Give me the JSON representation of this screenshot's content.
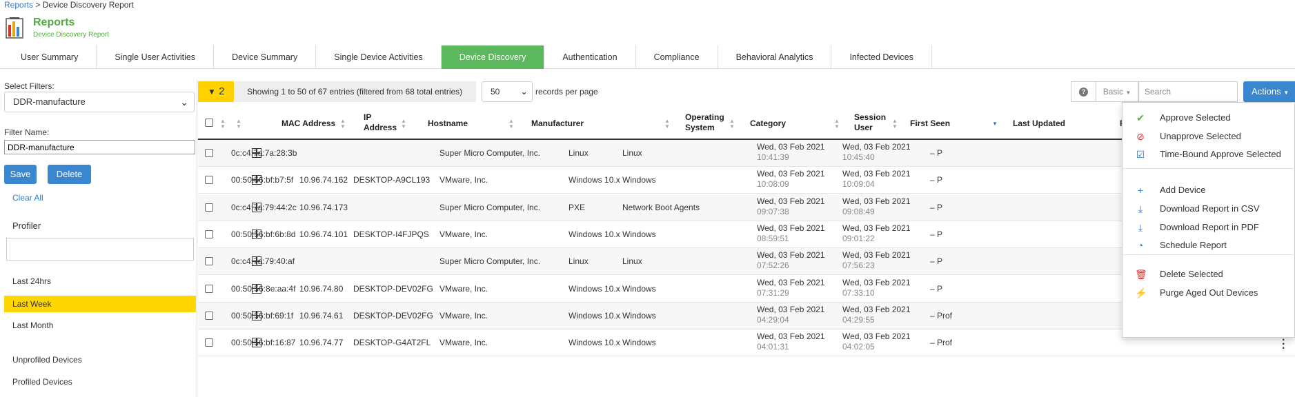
{
  "breadcrumb": {
    "root": "Reports",
    "sep": " > ",
    "current": "Device Discovery Report"
  },
  "header": {
    "title": "Reports",
    "subtitle": "Device Discovery Report"
  },
  "tabs": [
    "User Summary",
    "Single User Activities",
    "Device Summary",
    "Single Device Activities",
    "Device Discovery",
    "Authentication",
    "Compliance",
    "Behavioral Analytics",
    "Infected Devices"
  ],
  "active_tab": "Device Discovery",
  "left": {
    "select_filters_label": "Select Filters:",
    "selected_filter": "DDR-manufacture",
    "filter_name_label": "Filter Name:",
    "filter_name_value": "DDR-manufacture",
    "save": "Save",
    "delete": "Delete",
    "clear_all": "Clear All",
    "profiler_label": "Profiler",
    "time_items": [
      "Last 24hrs",
      "Last Week",
      "Last Month"
    ],
    "selected_time": "Last Week",
    "profile_items": [
      "Unprofiled Devices",
      "Profiled Devices"
    ]
  },
  "toolbar": {
    "filter_count": "2",
    "showing": "Showing 1 to 50 of 67 entries (filtered from 68 total entries)",
    "page_size": "50",
    "records_per_page": "records per page",
    "help": "?",
    "basic": "Basic",
    "search_placeholder": "Search",
    "actions": "Actions"
  },
  "columns": {
    "mac": "MAC Address",
    "ip_1": "IP",
    "ip_2": "Address",
    "hostname": "Hostname",
    "manufacturer": "Manufacturer",
    "os_1": "Operating",
    "os_2": "System",
    "category": "Category",
    "session_1": "Session",
    "session_2": "User",
    "first_seen": "First Seen",
    "last_updated": "Last Updated",
    "p": "P"
  },
  "rows": [
    {
      "mac": "0c:c4:7a:7a:28:3b",
      "ip": "",
      "hostname": "",
      "manufacturer": "Super Micro Computer, Inc.",
      "os": "Linux",
      "category": "Linux",
      "first_date": "Wed, 03 Feb 2021",
      "first_time": "10:41:39",
      "last_date": "Wed, 03 Feb 2021",
      "last_time": "10:45:40",
      "prof": "– P"
    },
    {
      "mac": "00:50:56:bf:b7:5f",
      "ip": "10.96.74.162",
      "hostname": "DESKTOP-A9CL193",
      "manufacturer": "VMware, Inc.",
      "os": "Windows 10.x",
      "category": "Windows",
      "first_date": "Wed, 03 Feb 2021",
      "first_time": "10:08:09",
      "last_date": "Wed, 03 Feb 2021",
      "last_time": "10:09:04",
      "prof": "– P"
    },
    {
      "mac": "0c:c4:7a:79:44:2c",
      "ip": "10.96.74.173",
      "hostname": "",
      "manufacturer": "Super Micro Computer, Inc.",
      "os": "PXE",
      "category": "Network Boot Agents",
      "first_date": "Wed, 03 Feb 2021",
      "first_time": "09:07:38",
      "last_date": "Wed, 03 Feb 2021",
      "last_time": "09:08:49",
      "prof": "– P"
    },
    {
      "mac": "00:50:56:bf:6b:8d",
      "ip": "10.96.74.101",
      "hostname": "DESKTOP-I4FJPQS",
      "manufacturer": "VMware, Inc.",
      "os": "Windows 10.x",
      "category": "Windows",
      "first_date": "Wed, 03 Feb 2021",
      "first_time": "08:59:51",
      "last_date": "Wed, 03 Feb 2021",
      "last_time": "09:01:22",
      "prof": "– P"
    },
    {
      "mac": "0c:c4:7a:79:40:af",
      "ip": "",
      "hostname": "",
      "manufacturer": "Super Micro Computer, Inc.",
      "os": "Linux",
      "category": "Linux",
      "first_date": "Wed, 03 Feb 2021",
      "first_time": "07:52:26",
      "last_date": "Wed, 03 Feb 2021",
      "last_time": "07:56:23",
      "prof": "– P"
    },
    {
      "mac": "00:50:56:8e:aa:4f",
      "ip": "10.96.74.80",
      "hostname": "DESKTOP-DEV02FG",
      "manufacturer": "VMware, Inc.",
      "os": "Windows 10.x",
      "category": "Windows",
      "first_date": "Wed, 03 Feb 2021",
      "first_time": "07:31:29",
      "last_date": "Wed, 03 Feb 2021",
      "last_time": "07:33:10",
      "prof": "– P"
    },
    {
      "mac": "00:50:56:bf:69:1f",
      "ip": "10.96.74.61",
      "hostname": "DESKTOP-DEV02FG",
      "manufacturer": "VMware, Inc.",
      "os": "Windows 10.x",
      "category": "Windows",
      "first_date": "Wed, 03 Feb 2021",
      "first_time": "04:29:04",
      "last_date": "Wed, 03 Feb 2021",
      "last_time": "04:29:55",
      "prof": "– Prof"
    },
    {
      "mac": "00:50:56:bf:16:87",
      "ip": "10.96.74.77",
      "hostname": "DESKTOP-G4AT2FL",
      "manufacturer": "VMware, Inc.",
      "os": "Windows 10.x",
      "category": "Windows",
      "first_date": "Wed, 03 Feb 2021",
      "first_time": "04:01:31",
      "last_date": "Wed, 03 Feb 2021",
      "last_time": "04:02:05",
      "prof": "– Prof"
    }
  ],
  "actions_menu": [
    {
      "label": "Approve Selected",
      "icon": "check-icon",
      "color": "#4fae3c"
    },
    {
      "label": "Unapprove Selected",
      "icon": "ban-icon",
      "color": "#e0312f"
    },
    {
      "label": "Time-Bound Approve Selected",
      "icon": "check-circle-icon",
      "color": "#2b7cc9"
    },
    {
      "label": "Add Device",
      "icon": "plus-icon",
      "color": "#2b7cc9"
    },
    {
      "label": "Download Report in CSV",
      "icon": "download-icon",
      "color": "#2b7cc9"
    },
    {
      "label": "Download Report in PDF",
      "icon": "download-icon",
      "color": "#2b7cc9"
    },
    {
      "label": "Schedule Report",
      "icon": "clock-icon",
      "color": "#2b7cc9"
    },
    {
      "label": "Delete Selected",
      "icon": "trash-icon",
      "color": "#e0312f"
    },
    {
      "label": "Purge Aged Out Devices",
      "icon": "bolt-icon",
      "color": "#2b7cc9"
    }
  ]
}
